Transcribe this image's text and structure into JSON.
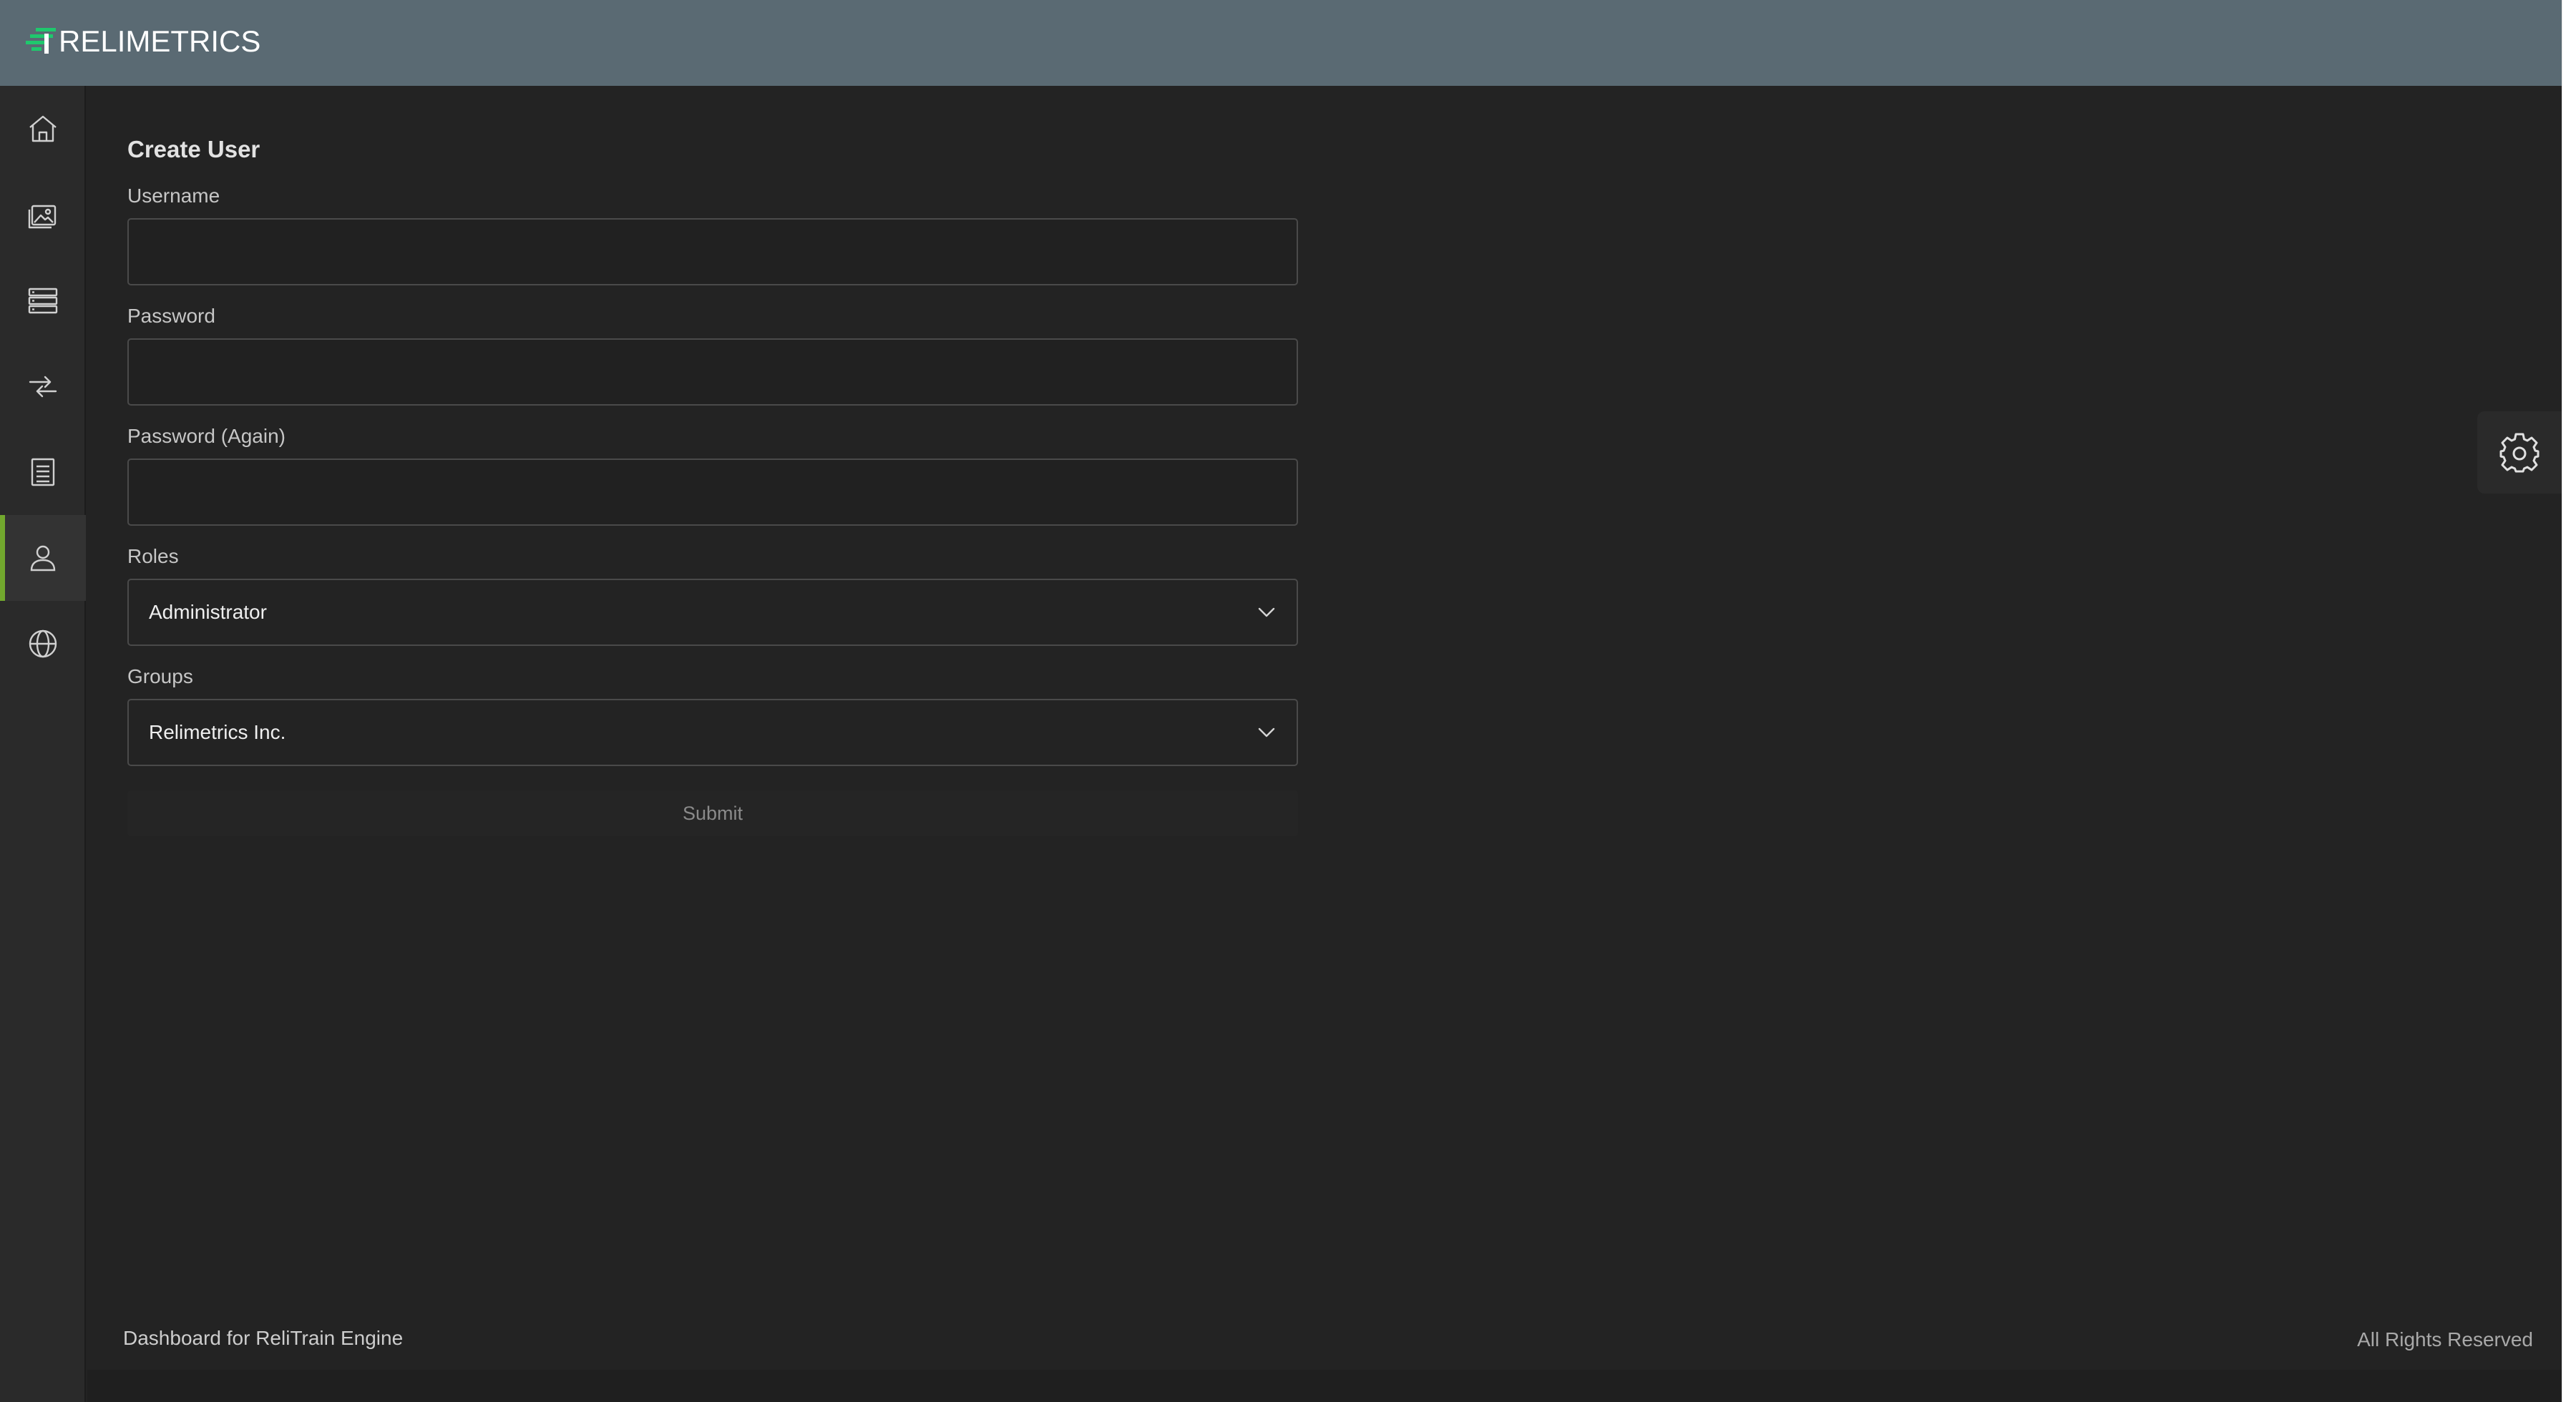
{
  "brand": {
    "name": "RELIMETRICS",
    "mark_color": "#1fc86d",
    "accent_color": "#72a82e"
  },
  "sidebar": {
    "items": [
      {
        "icon": "home-icon",
        "active": false
      },
      {
        "icon": "images-icon",
        "active": false
      },
      {
        "icon": "database-icon",
        "active": false
      },
      {
        "icon": "transfer-icon",
        "active": false
      },
      {
        "icon": "document-list-icon",
        "active": false
      },
      {
        "icon": "user-icon",
        "active": true
      },
      {
        "icon": "globe-icon",
        "active": false
      }
    ]
  },
  "form": {
    "title": "Create User",
    "username": {
      "label": "Username",
      "value": ""
    },
    "password": {
      "label": "Password",
      "value": ""
    },
    "password_again": {
      "label": "Password (Again)",
      "value": ""
    },
    "roles": {
      "label": "Roles",
      "selected": "Administrator"
    },
    "groups": {
      "label": "Groups",
      "selected": "Relimetrics Inc."
    },
    "submit_label": "Submit"
  },
  "settings": {
    "icon": "gear-icon"
  },
  "footer": {
    "left": "Dashboard for ReliTrain Engine",
    "right": "All Rights Reserved"
  }
}
